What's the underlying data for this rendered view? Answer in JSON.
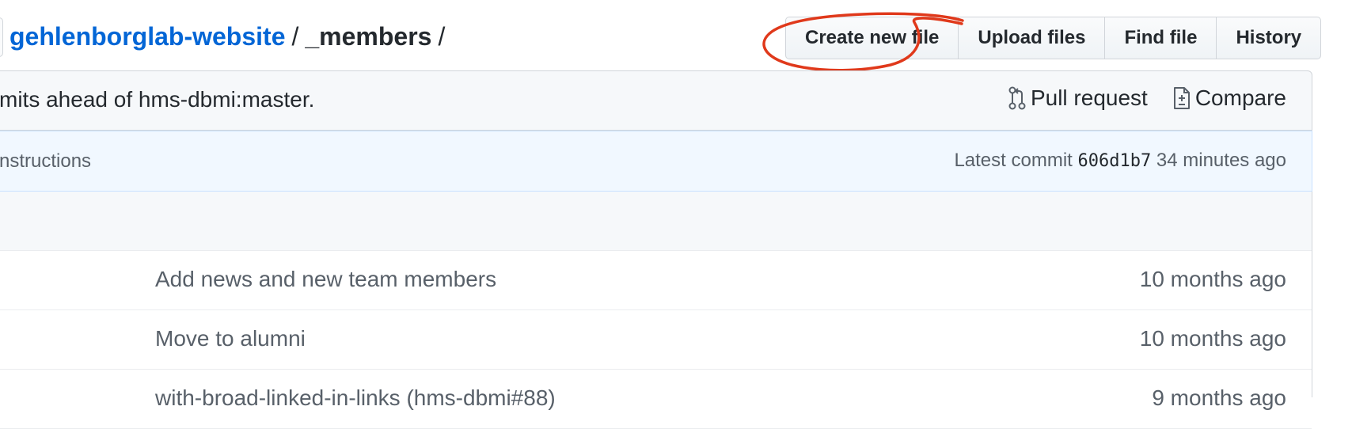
{
  "breadcrumb": {
    "repo": "gehlenborglab-website",
    "separator": "/",
    "directory": "_members",
    "trailing": "/"
  },
  "file_buttons": [
    {
      "label": "Create new file"
    },
    {
      "label": "Upload files"
    },
    {
      "label": "Find file"
    },
    {
      "label": "History"
    }
  ],
  "annotation": {
    "shape": "hand-drawn circle",
    "color": "#e0391b",
    "target": "Create new file"
  },
  "fork_status": {
    "text": "mits ahead of hms-dbmi:master.",
    "pull_request_label": "Pull request",
    "pull_request_icon": "git-pull-request-icon",
    "compare_label": "Compare",
    "compare_icon": "file-diff-icon"
  },
  "latest_commit": {
    "message": "nstructions",
    "prefix": "Latest commit",
    "sha": "606d1b7",
    "age": "34 minutes ago"
  },
  "file_list": [
    {
      "message": "Add news and new team members",
      "age": "10 months ago"
    },
    {
      "message": "Move to alumni",
      "age": "10 months ago"
    },
    {
      "message": "with-broad-linked-in-links (hms-dbmi#88)",
      "age": "9 months ago"
    }
  ],
  "colors": {
    "link": "#0366d6",
    "text": "#24292e",
    "muted": "#586069",
    "commit_bar_bg": "#f1f8ff",
    "border": "#d1d5da"
  }
}
